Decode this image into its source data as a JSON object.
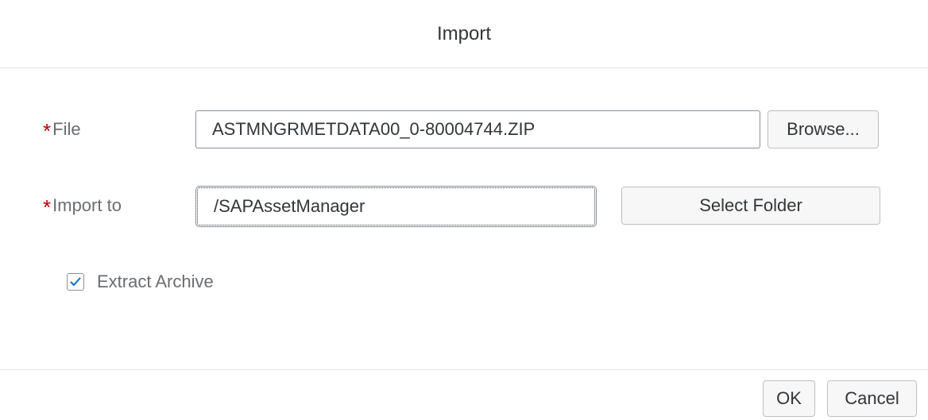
{
  "dialog": {
    "title": "Import"
  },
  "form": {
    "file": {
      "required_mark": "*",
      "label": "File",
      "value": "ASTMNGRMETDATA00_0-80004744.ZIP",
      "browse_label": "Browse..."
    },
    "import_to": {
      "required_mark": "*",
      "label": "Import to",
      "value": "/SAPAssetManager",
      "select_folder_label": "Select Folder"
    },
    "extract_archive": {
      "label": "Extract Archive",
      "checked": true
    }
  },
  "footer": {
    "ok_label": "OK",
    "cancel_label": "Cancel"
  },
  "colors": {
    "required": "#bb0000",
    "checkmark": "#0a6ed1",
    "border": "#89919a",
    "button_bg": "#f7f7f7"
  }
}
